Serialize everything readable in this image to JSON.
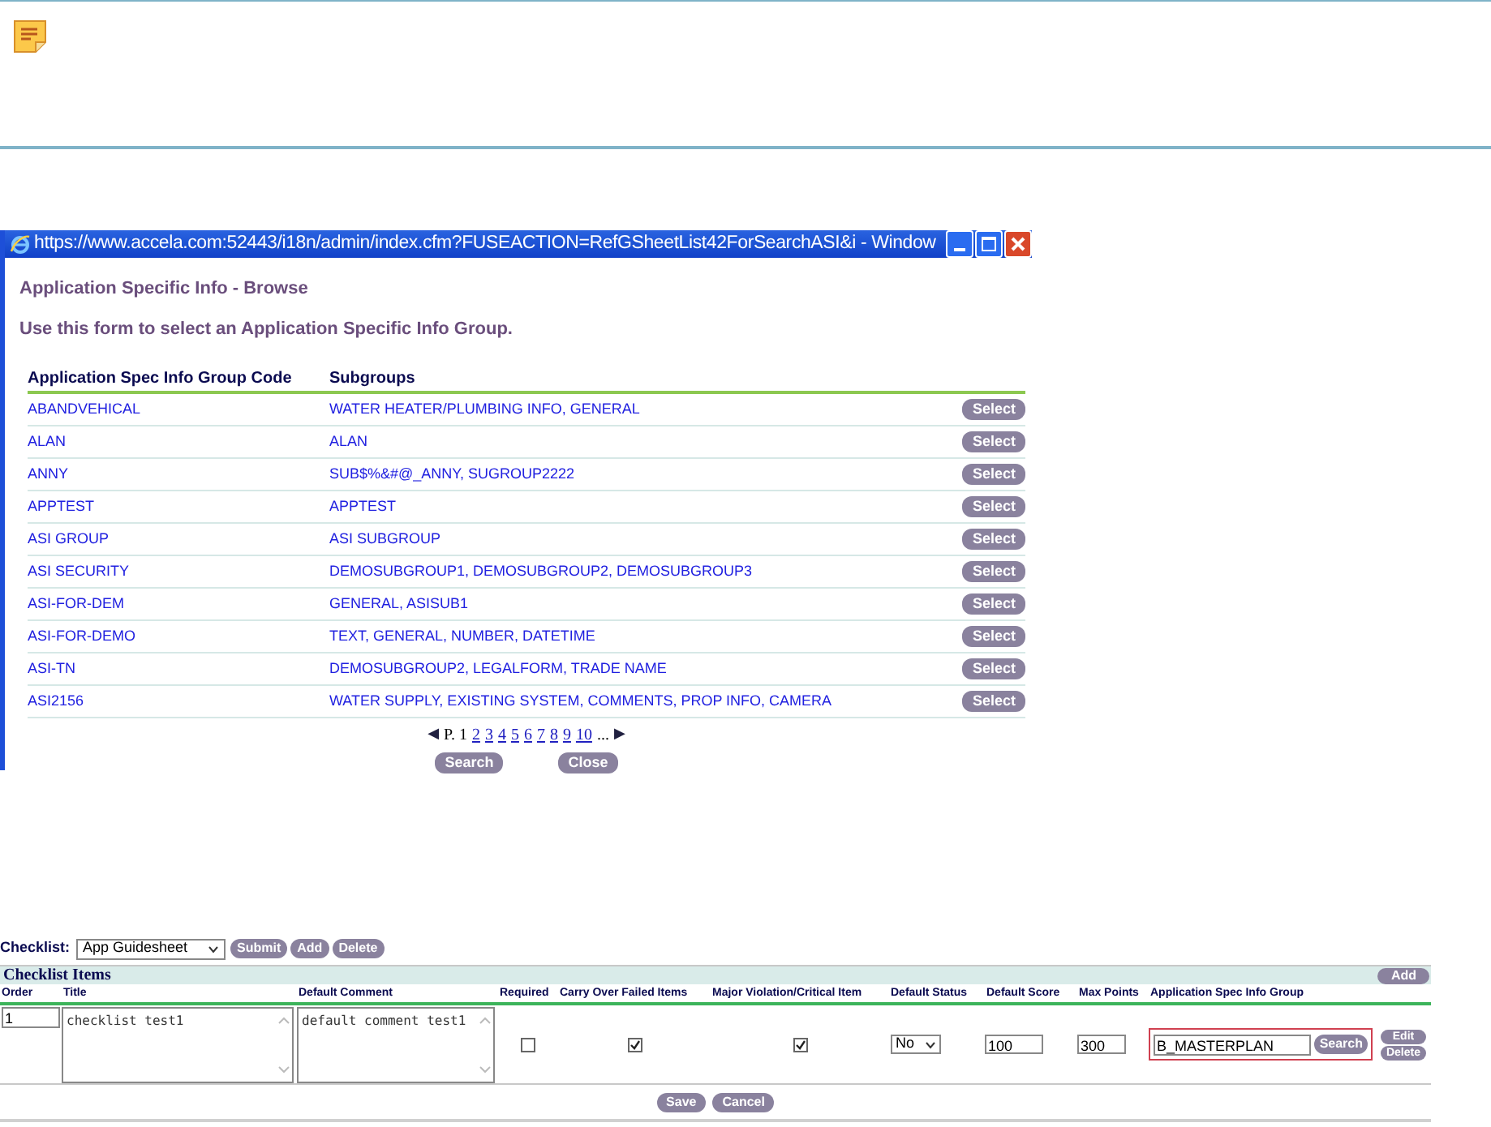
{
  "popup": {
    "title": "https://www.accela.com:52443/i18n/admin/index.cfm?FUSEACTION=RefGSheetList42ForSearchASI&i - Window",
    "heading": "Application Specific Info - Browse",
    "instruction": "Use this form to select an Application Specific Info Group.",
    "columns": [
      "Application Spec Info Group Code",
      "Subgroups"
    ],
    "rows": [
      {
        "code": "ABANDVEHICAL",
        "subgroups": "WATER HEATER/PLUMBING INFO, GENERAL",
        "action": "Select"
      },
      {
        "code": "ALAN",
        "subgroups": "ALAN",
        "action": "Select"
      },
      {
        "code": "ANNY",
        "subgroups": "SUB$%&#@_ANNY, SUGROUP2222",
        "action": "Select"
      },
      {
        "code": "APPTEST",
        "subgroups": "APPTEST",
        "action": "Select"
      },
      {
        "code": "ASI GROUP",
        "subgroups": "ASI SUBGROUP",
        "action": "Select"
      },
      {
        "code": "ASI SECURITY",
        "subgroups": "DEMOSUBGROUP1, DEMOSUBGROUP2, DEMOSUBGROUP3",
        "action": "Select"
      },
      {
        "code": "ASI-FOR-DEM",
        "subgroups": "GENERAL, ASISUB1",
        "action": "Select"
      },
      {
        "code": "ASI-FOR-DEMO",
        "subgroups": "TEXT, GENERAL, NUMBER, DATETIME",
        "action": "Select"
      },
      {
        "code": "ASI-TN",
        "subgroups": "DEMOSUBGROUP2, LEGALFORM, TRADE NAME",
        "action": "Select"
      },
      {
        "code": "ASI2156",
        "subgroups": "WATER SUPPLY, EXISTING SYSTEM, COMMENTS, PROP INFO, CAMERA",
        "action": "Select"
      }
    ],
    "pagination": {
      "prev": "◀",
      "current": "P. 1",
      "pages": [
        "2",
        "3",
        "4",
        "5",
        "6",
        "7",
        "8",
        "9",
        "10"
      ],
      "more": "...",
      "next": "▶"
    },
    "buttons": [
      "Search",
      "Close"
    ]
  },
  "checklist": {
    "label": "Checklist:",
    "value": "App Guidesheet",
    "buttons": [
      "Submit",
      "Add",
      "Delete"
    ],
    "section_title": "Checklist Items",
    "section_button": "Add",
    "columns": [
      "Order",
      "Title",
      "Default Comment",
      "Required",
      "Carry Over Failed Items",
      "Major Violation/Critical Item",
      "Default Status",
      "Default Score",
      "Max Points",
      "Application Spec Info Group"
    ],
    "item": {
      "order": "1",
      "title": "checklist test1",
      "default_comment": "default comment test1",
      "required": false,
      "carry_over": true,
      "major_violation": true,
      "default_status": "No",
      "default_score": "100",
      "max_points": "300",
      "asi_group": "B_MASTERPLAN",
      "search_button": "Search",
      "row_buttons": [
        "Edit",
        "Delete"
      ]
    },
    "footer_buttons": [
      "Save",
      "Cancel"
    ]
  }
}
